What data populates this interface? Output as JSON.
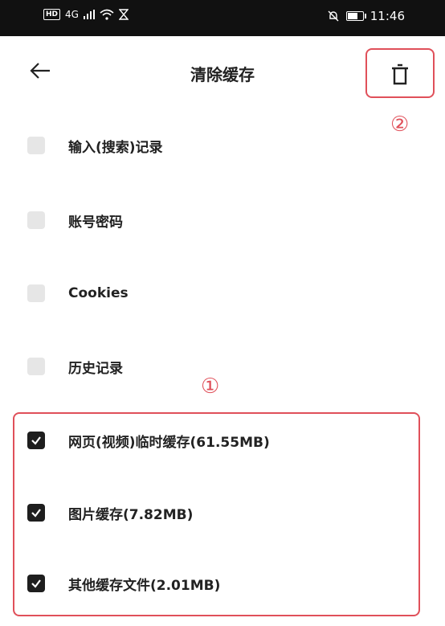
{
  "status_bar": {
    "network": "4G",
    "hd": "HD",
    "time": "11:46"
  },
  "header": {
    "title": "清除缓存",
    "back_icon": "arrow-left-icon",
    "delete_icon": "trash-icon"
  },
  "annotations": {
    "marker_1": "①",
    "marker_2": "②",
    "color": "#e0505a"
  },
  "options": [
    {
      "label": "输入(搜索)记录",
      "checked": false
    },
    {
      "label": "账号密码",
      "checked": false
    },
    {
      "label": "Cookies",
      "checked": false
    },
    {
      "label": "历史记录",
      "checked": false
    },
    {
      "label": "网页(视频)临时缓存(61.55MB)",
      "checked": true
    },
    {
      "label": "图片缓存(7.82MB)",
      "checked": true
    },
    {
      "label": "其他缓存文件(2.01MB)",
      "checked": true
    }
  ]
}
